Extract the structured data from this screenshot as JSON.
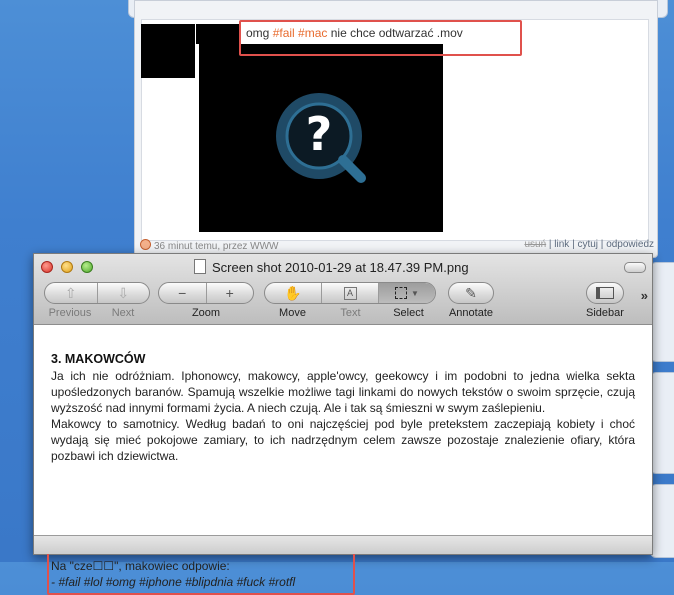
{
  "post": {
    "status_prefix": "omg ",
    "tag1": "#fail",
    "tag2": "#mac",
    "status_suffix": " nie chce odtwarzać .mov",
    "footer_time": "36 minut temu, przez WWW",
    "footer_actions": {
      "delete": "usuń",
      "link": "link",
      "quote": "cytuj",
      "reply": "odpowiedz"
    }
  },
  "window": {
    "title": "Screen shot 2010-01-29 at 18.47.39 PM.png",
    "toolbar": {
      "previous": "Previous",
      "next": "Next",
      "zoom": "Zoom",
      "move": "Move",
      "text": "Text",
      "select": "Select",
      "annotate": "Annotate",
      "sidebar": "Sidebar",
      "zoom_out_glyph": "−",
      "zoom_in_glyph": "+",
      "chevron": "»"
    }
  },
  "document": {
    "heading": "3. MAKOWCÓW",
    "para1": "Ja ich nie odróżniam. Iphonowcy, makowcy, apple'owcy, geekowcy i im podobni to jedna wielka sekta upośledzonych baranów. Spamują wszelkie możliwe tagi linkami do nowych tekstów o swoim sprzęcie, czują wyższość nad innymi formami życia. A niech czują. Ale i tak są śmieszni w swym zaślepieniu.",
    "para2": "Makowcy to samotnicy. Według badań to oni najczęściej pod byle pretekstem zaczepiają kobiety i choć wydają się mieć pokojowe zamiary, to ich nadrzędnym celem zawsze pozostaje znalezienie ofiary, która pozbawi ich dziewictwa.",
    "quote_line": "Na \"cze☐☐\", makowiec odpowie:",
    "tags_line": "- #fail #lol #omg #iphone #blipdnia #fuck #rotfl"
  },
  "colors": {
    "tag": "#e86b2e",
    "highlight_box": "#e0514c",
    "desktop": "#3f7fcf"
  }
}
